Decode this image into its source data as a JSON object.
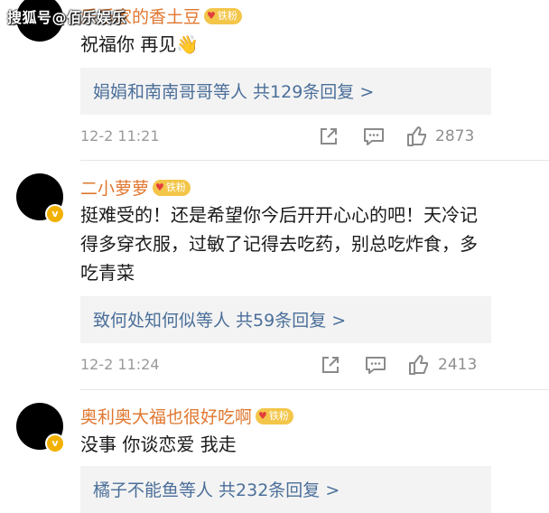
{
  "watermark": "搜狐号@佰乐娱乐",
  "fan_badge_label": "铁粉",
  "verified_mark": "v",
  "comments": [
    {
      "username": "乐乐家的香土豆",
      "text": "祝福你 再见👋",
      "reply_summary": "娟娟和南南哥哥等人 共129条回复 >",
      "time": "12-2 11:21",
      "likes": "2873"
    },
    {
      "username": "二小萝萝",
      "text": "挺难受的！还是希望你今后开开心心的吧！天冷记得多穿衣服，过敏了记得去吃药，别总吃炸食，多吃青菜",
      "reply_summary": "致何处知何似等人 共59条回复 >",
      "time": "12-2 11:24",
      "likes": "2413"
    },
    {
      "username": "奥利奥大福也很好吃啊",
      "text": "没事 你谈恋爱 我走",
      "reply_summary": "橘子不能鱼等人 共232条回复 >"
    }
  ]
}
